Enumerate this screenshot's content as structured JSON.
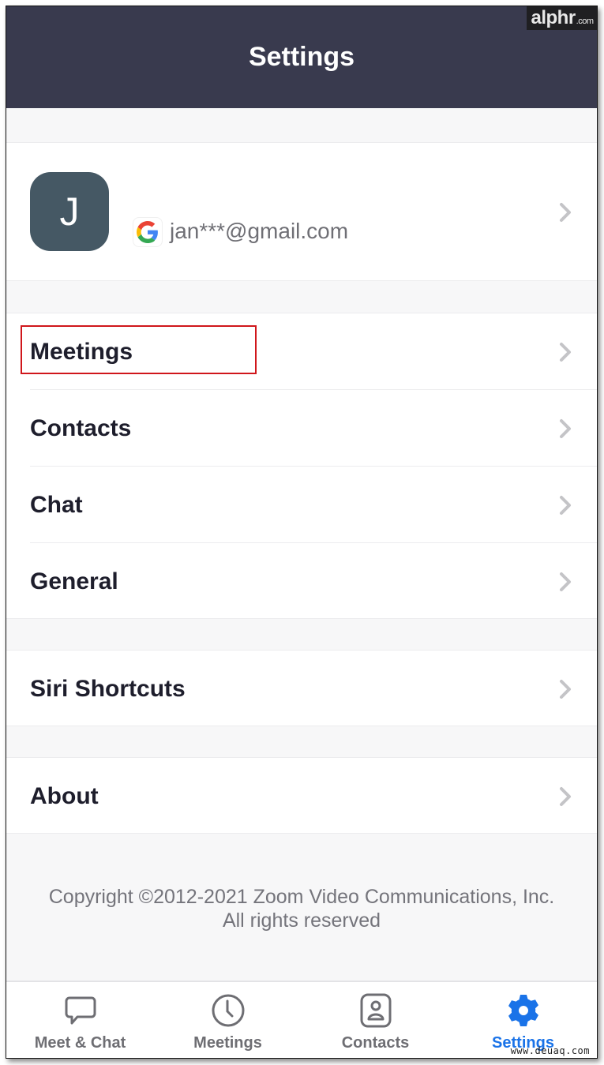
{
  "watermark": {
    "brand": "alphr",
    "suffix": ".com"
  },
  "header": {
    "title": "Settings"
  },
  "profile": {
    "avatar_initial": "J",
    "account_provider_icon": "google-icon",
    "email": "jan***@gmail.com"
  },
  "groups": [
    {
      "items": [
        {
          "label": "Meetings",
          "highlighted": true
        },
        {
          "label": "Contacts"
        },
        {
          "label": "Chat"
        },
        {
          "label": "General"
        }
      ]
    },
    {
      "items": [
        {
          "label": "Siri Shortcuts"
        }
      ]
    },
    {
      "items": [
        {
          "label": "About"
        }
      ]
    }
  ],
  "footer": {
    "copyright_line1": "Copyright ©2012-2021 Zoom Video Communications, Inc.",
    "copyright_line2": "All rights reserved"
  },
  "tabbar": {
    "tabs": [
      {
        "label": "Meet & Chat",
        "icon": "chat-bubble-icon",
        "active": false
      },
      {
        "label": "Meetings",
        "icon": "clock-icon",
        "active": false
      },
      {
        "label": "Contacts",
        "icon": "contact-card-icon",
        "active": false
      },
      {
        "label": "Settings",
        "icon": "gear-icon",
        "active": true
      }
    ]
  },
  "colors": {
    "header_bg": "#393a4e",
    "accent": "#1a73e8",
    "highlight": "#d0161b",
    "avatar_bg": "#455864"
  },
  "site_watermark": "www.deuaq.com"
}
